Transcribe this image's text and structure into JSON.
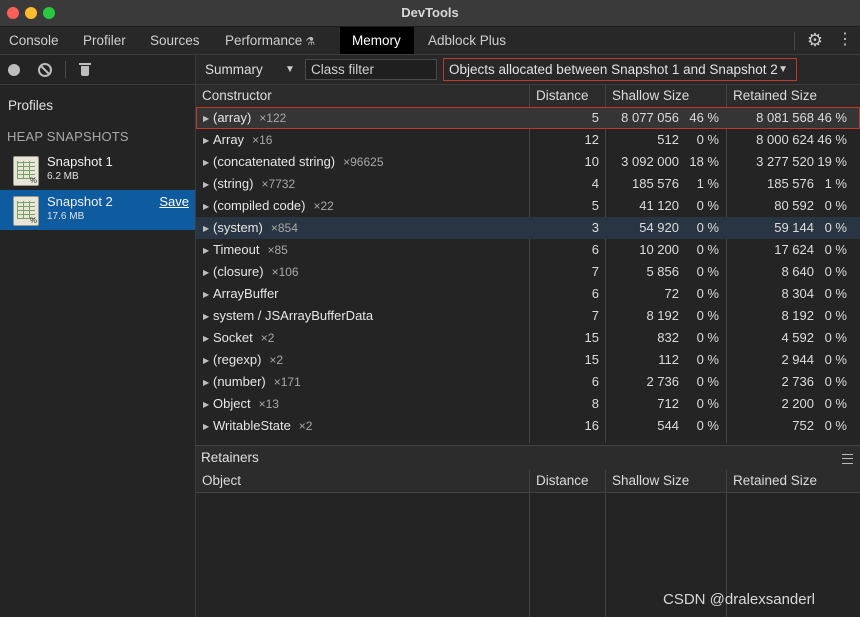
{
  "window": {
    "title": "DevTools"
  },
  "tabs": [
    {
      "label": "Console"
    },
    {
      "label": "Profiler"
    },
    {
      "label": "Sources"
    },
    {
      "label": "Performance"
    },
    {
      "label": "Memory",
      "active": true
    },
    {
      "label": "Adblock Plus"
    }
  ],
  "sidebar": {
    "profiles_title": "Profiles",
    "heap_snapshots_title": "HEAP SNAPSHOTS",
    "snapshots": [
      {
        "name": "Snapshot 1",
        "size": "6.2 MB"
      },
      {
        "name": "Snapshot 2",
        "size": "17.6 MB",
        "selected": true,
        "save_label": "Save"
      }
    ]
  },
  "toolbar": {
    "view": "Summary",
    "class_filter_placeholder": "Class filter",
    "range": "Objects allocated between Snapshot 1 and Snapshot 2"
  },
  "table": {
    "headers": [
      "Constructor",
      "Distance",
      "Shallow Size",
      "Retained Size"
    ],
    "rows": [
      {
        "name": "(array)",
        "count": "×122",
        "distance": "5",
        "shallow": "8 077 056",
        "shallow_pct": "46 %",
        "retained": "8 081 568",
        "retained_pct": "46 %",
        "highlighted": true
      },
      {
        "name": "Array",
        "count": "×16",
        "distance": "12",
        "shallow": "512",
        "shallow_pct": "0 %",
        "retained": "8 000 624",
        "retained_pct": "46 %"
      },
      {
        "name": "(concatenated string)",
        "count": "×96625",
        "distance": "10",
        "shallow": "3 092 000",
        "shallow_pct": "18 %",
        "retained": "3 277 520",
        "retained_pct": "19 %"
      },
      {
        "name": "(string)",
        "count": "×7732",
        "distance": "4",
        "shallow": "185 576",
        "shallow_pct": "1 %",
        "retained": "185 576",
        "retained_pct": "1 %"
      },
      {
        "name": "(compiled code)",
        "count": "×22",
        "distance": "5",
        "shallow": "41 120",
        "shallow_pct": "0 %",
        "retained": "80 592",
        "retained_pct": "0 %"
      },
      {
        "name": "(system)",
        "count": "×854",
        "distance": "3",
        "shallow": "54 920",
        "shallow_pct": "0 %",
        "retained": "59 144",
        "retained_pct": "0 %",
        "alt": true
      },
      {
        "name": "Timeout",
        "count": "×85",
        "distance": "6",
        "shallow": "10 200",
        "shallow_pct": "0 %",
        "retained": "17 624",
        "retained_pct": "0 %"
      },
      {
        "name": "(closure)",
        "count": "×106",
        "distance": "7",
        "shallow": "5 856",
        "shallow_pct": "0 %",
        "retained": "8 640",
        "retained_pct": "0 %"
      },
      {
        "name": "ArrayBuffer",
        "count": "",
        "distance": "6",
        "shallow": "72",
        "shallow_pct": "0 %",
        "retained": "8 304",
        "retained_pct": "0 %"
      },
      {
        "name": "system / JSArrayBufferData",
        "count": "",
        "distance": "7",
        "shallow": "8 192",
        "shallow_pct": "0 %",
        "retained": "8 192",
        "retained_pct": "0 %"
      },
      {
        "name": "Socket",
        "count": "×2",
        "distance": "15",
        "shallow": "832",
        "shallow_pct": "0 %",
        "retained": "4 592",
        "retained_pct": "0 %"
      },
      {
        "name": "(regexp)",
        "count": "×2",
        "distance": "15",
        "shallow": "112",
        "shallow_pct": "0 %",
        "retained": "2 944",
        "retained_pct": "0 %"
      },
      {
        "name": "(number)",
        "count": "×171",
        "distance": "6",
        "shallow": "2 736",
        "shallow_pct": "0 %",
        "retained": "2 736",
        "retained_pct": "0 %"
      },
      {
        "name": "Object",
        "count": "×13",
        "distance": "8",
        "shallow": "712",
        "shallow_pct": "0 %",
        "retained": "2 200",
        "retained_pct": "0 %"
      },
      {
        "name": "WritableState",
        "count": "×2",
        "distance": "16",
        "shallow": "544",
        "shallow_pct": "0 %",
        "retained": "752",
        "retained_pct": "0 %"
      }
    ]
  },
  "retainers": {
    "title": "Retainers",
    "headers": [
      "Object",
      "Distance",
      "Shallow Size",
      "Retained Size"
    ]
  },
  "watermark": "CSDN @dralexsanderl"
}
